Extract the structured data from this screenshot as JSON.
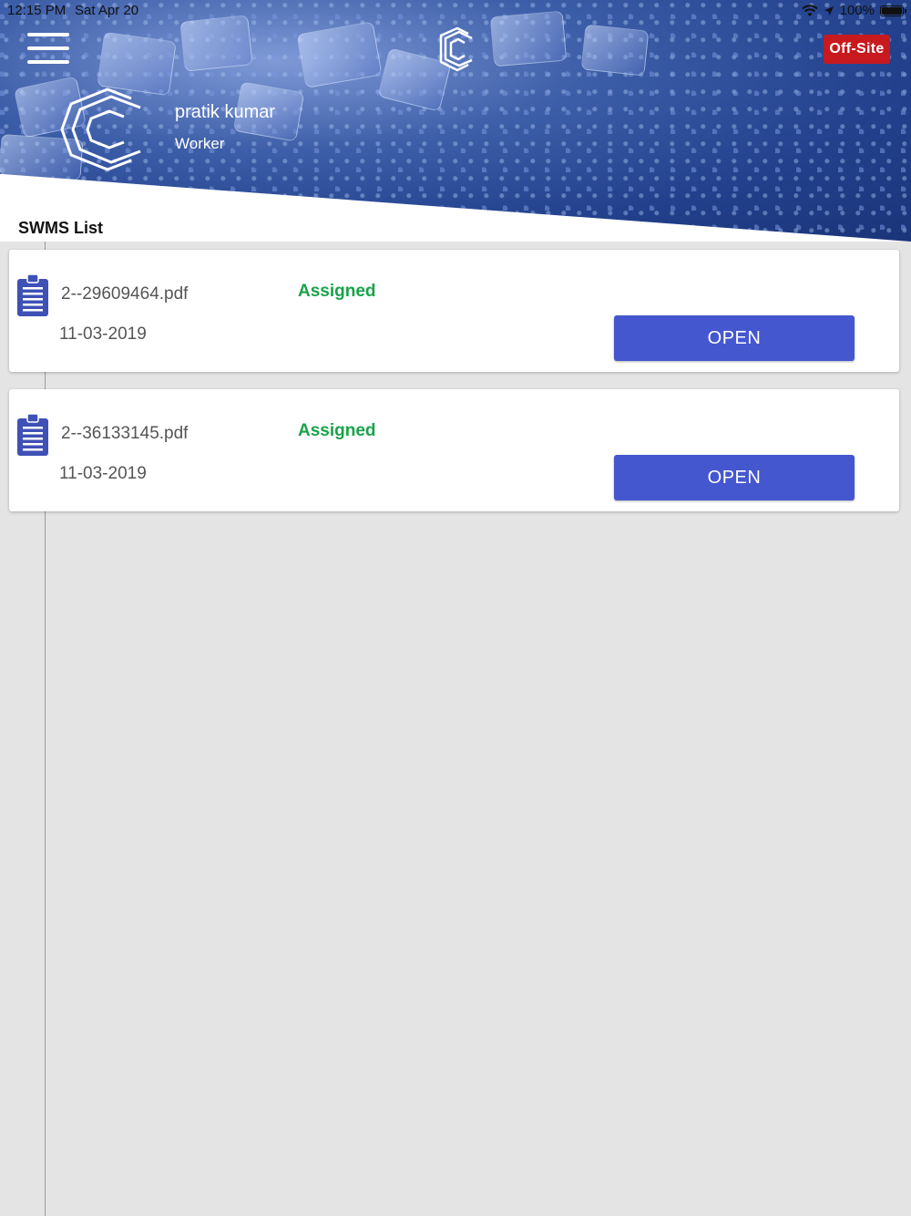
{
  "status_bar": {
    "time": "12:15 PM",
    "date": "Sat Apr 20",
    "battery": "100%"
  },
  "header": {
    "badge": "Off-Site",
    "badge_color": "#c8191e",
    "user_name": "pratik kumar",
    "user_role": "Worker"
  },
  "list": {
    "title": "SWMS List",
    "items": [
      {
        "file": "2--29609464.pdf",
        "date": "11-03-2019",
        "status": "Assigned",
        "action": "OPEN"
      },
      {
        "file": "2--36133145.pdf",
        "date": "11-03-2019",
        "status": "Assigned",
        "action": "OPEN"
      }
    ]
  },
  "colors": {
    "accent": "#4557cf",
    "status_assigned": "#1aa24a",
    "header_blue": "#22408c"
  }
}
